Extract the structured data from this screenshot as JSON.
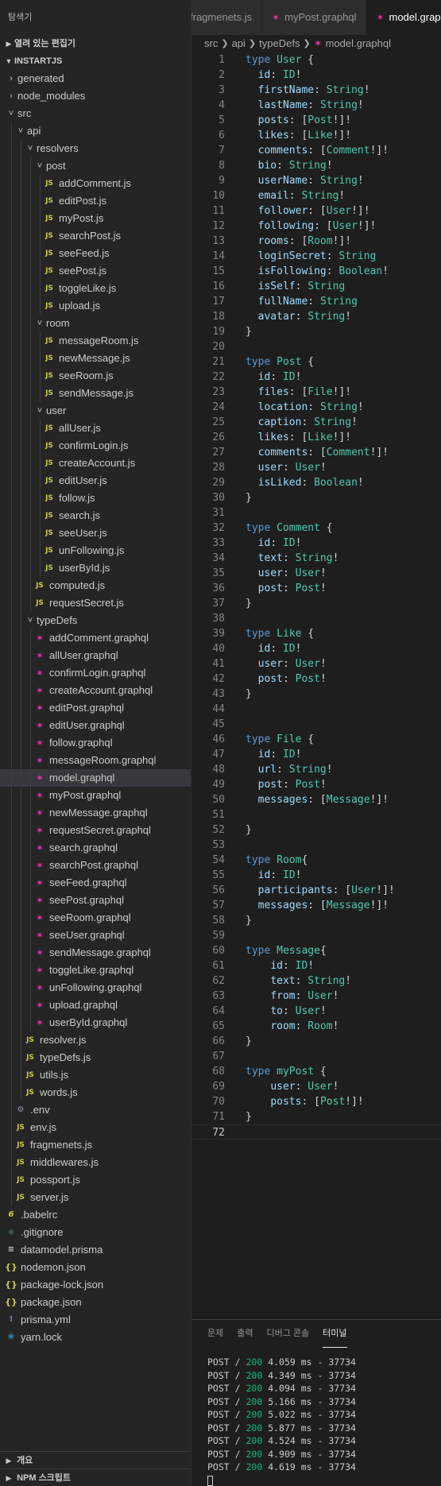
{
  "sidebar": {
    "title": "탐색기",
    "open_editors_label": "열려 있는 편집기",
    "project_label": "INSTARTJS",
    "bottom_sections": [
      "개요",
      "NPM 스크립트"
    ]
  },
  "tree": [
    {
      "label": "generated",
      "depth": 0,
      "kind": "folder",
      "open": false
    },
    {
      "label": "node_modules",
      "depth": 0,
      "kind": "folder",
      "open": false
    },
    {
      "label": "src",
      "depth": 0,
      "kind": "folder",
      "open": true
    },
    {
      "label": "api",
      "depth": 1,
      "kind": "folder",
      "open": true
    },
    {
      "label": "resolvers",
      "depth": 2,
      "kind": "folder",
      "open": true
    },
    {
      "label": "post",
      "depth": 3,
      "kind": "folder",
      "open": true
    },
    {
      "label": "addComment.js",
      "depth": 4,
      "kind": "js"
    },
    {
      "label": "editPost.js",
      "depth": 4,
      "kind": "js"
    },
    {
      "label": "myPost.js",
      "depth": 4,
      "kind": "js"
    },
    {
      "label": "searchPost.js",
      "depth": 4,
      "kind": "js"
    },
    {
      "label": "seeFeed.js",
      "depth": 4,
      "kind": "js"
    },
    {
      "label": "seePost.js",
      "depth": 4,
      "kind": "js"
    },
    {
      "label": "toggleLike.js",
      "depth": 4,
      "kind": "js"
    },
    {
      "label": "upload.js",
      "depth": 4,
      "kind": "js"
    },
    {
      "label": "room",
      "depth": 3,
      "kind": "folder",
      "open": true
    },
    {
      "label": "messageRoom.js",
      "depth": 4,
      "kind": "js"
    },
    {
      "label": "newMessage.js",
      "depth": 4,
      "kind": "js"
    },
    {
      "label": "seeRoom.js",
      "depth": 4,
      "kind": "js"
    },
    {
      "label": "sendMessage.js",
      "depth": 4,
      "kind": "js"
    },
    {
      "label": "user",
      "depth": 3,
      "kind": "folder",
      "open": true
    },
    {
      "label": "allUser.js",
      "depth": 4,
      "kind": "js"
    },
    {
      "label": "confirmLogin.js",
      "depth": 4,
      "kind": "js"
    },
    {
      "label": "createAccount.js",
      "depth": 4,
      "kind": "js"
    },
    {
      "label": "editUser.js",
      "depth": 4,
      "kind": "js"
    },
    {
      "label": "follow.js",
      "depth": 4,
      "kind": "js"
    },
    {
      "label": "search.js",
      "depth": 4,
      "kind": "js"
    },
    {
      "label": "seeUser.js",
      "depth": 4,
      "kind": "js"
    },
    {
      "label": "unFollowing.js",
      "depth": 4,
      "kind": "js"
    },
    {
      "label": "userById.js",
      "depth": 4,
      "kind": "js"
    },
    {
      "label": "computed.js",
      "depth": 3,
      "kind": "js"
    },
    {
      "label": "requestSecret.js",
      "depth": 3,
      "kind": "js"
    },
    {
      "label": "typeDefs",
      "depth": 2,
      "kind": "folder",
      "open": true
    },
    {
      "label": "addComment.graphql",
      "depth": 3,
      "kind": "graphql"
    },
    {
      "label": "allUser.graphql",
      "depth": 3,
      "kind": "graphql"
    },
    {
      "label": "confirmLogin.graphql",
      "depth": 3,
      "kind": "graphql"
    },
    {
      "label": "createAccount.graphql",
      "depth": 3,
      "kind": "graphql"
    },
    {
      "label": "editPost.graphql",
      "depth": 3,
      "kind": "graphql"
    },
    {
      "label": "editUser.graphql",
      "depth": 3,
      "kind": "graphql"
    },
    {
      "label": "follow.graphql",
      "depth": 3,
      "kind": "graphql"
    },
    {
      "label": "messageRoom.graphql",
      "depth": 3,
      "kind": "graphql"
    },
    {
      "label": "model.graphql",
      "depth": 3,
      "kind": "graphql",
      "active": true
    },
    {
      "label": "myPost.graphql",
      "depth": 3,
      "kind": "graphql"
    },
    {
      "label": "newMessage.graphql",
      "depth": 3,
      "kind": "graphql"
    },
    {
      "label": "requestSecret.graphql",
      "depth": 3,
      "kind": "graphql"
    },
    {
      "label": "search.graphql",
      "depth": 3,
      "kind": "graphql"
    },
    {
      "label": "searchPost.graphql",
      "depth": 3,
      "kind": "graphql"
    },
    {
      "label": "seeFeed.graphql",
      "depth": 3,
      "kind": "graphql"
    },
    {
      "label": "seePost.graphql",
      "depth": 3,
      "kind": "graphql"
    },
    {
      "label": "seeRoom.graphql",
      "depth": 3,
      "kind": "graphql"
    },
    {
      "label": "seeUser.graphql",
      "depth": 3,
      "kind": "graphql"
    },
    {
      "label": "sendMessage.graphql",
      "depth": 3,
      "kind": "graphql"
    },
    {
      "label": "toggleLike.graphql",
      "depth": 3,
      "kind": "graphql"
    },
    {
      "label": "unFollowing.graphql",
      "depth": 3,
      "kind": "graphql"
    },
    {
      "label": "upload.graphql",
      "depth": 3,
      "kind": "graphql"
    },
    {
      "label": "userById.graphql",
      "depth": 3,
      "kind": "graphql"
    },
    {
      "label": "resolver.js",
      "depth": 2,
      "kind": "js"
    },
    {
      "label": "typeDefs.js",
      "depth": 2,
      "kind": "js"
    },
    {
      "label": "utils.js",
      "depth": 2,
      "kind": "js"
    },
    {
      "label": "words.js",
      "depth": 2,
      "kind": "js"
    },
    {
      "label": ".env",
      "depth": 1,
      "kind": "env"
    },
    {
      "label": "env.js",
      "depth": 1,
      "kind": "js"
    },
    {
      "label": "fragmenets.js",
      "depth": 1,
      "kind": "js"
    },
    {
      "label": "middlewares.js",
      "depth": 1,
      "kind": "js"
    },
    {
      "label": "possport.js",
      "depth": 1,
      "kind": "js"
    },
    {
      "label": "server.js",
      "depth": 1,
      "kind": "js"
    },
    {
      "label": ".babelrc",
      "depth": 0,
      "kind": "babel"
    },
    {
      "label": ".gitignore",
      "depth": 0,
      "kind": "git"
    },
    {
      "label": "datamodel.prisma",
      "depth": 0,
      "kind": "prisma"
    },
    {
      "label": "nodemon.json",
      "depth": 0,
      "kind": "json"
    },
    {
      "label": "package-lock.json",
      "depth": 0,
      "kind": "json"
    },
    {
      "label": "package.json",
      "depth": 0,
      "kind": "json"
    },
    {
      "label": "prisma.yml",
      "depth": 0,
      "kind": "yml"
    },
    {
      "label": "yarn.lock",
      "depth": 0,
      "kind": "yarn"
    }
  ],
  "icons": {
    "folder_open": "chevron-down-icon",
    "folder_closed": "chevron-right-icon",
    "js": "JS",
    "graphql": "graphql-icon",
    "json": "{}",
    "yml": "!",
    "env": "gear-icon"
  },
  "tabs": [
    {
      "label": "fragmenets.js",
      "kind": "js",
      "active": false
    },
    {
      "label": "myPost.graphql",
      "kind": "graphql",
      "active": false
    },
    {
      "label": "model.graphql",
      "kind": "graphql",
      "active": true
    }
  ],
  "breadcrumb": [
    "src",
    "api",
    "typeDefs",
    "model.graphql"
  ],
  "code_lines": [
    "type User {",
    "  id: ID!",
    "  firstName: String!",
    "  lastName: String!",
    "  posts: [Post!]!",
    "  likes: [Like!]!",
    "  comments: [Comment!]!",
    "  bio: String!",
    "  userName: String!",
    "  email: String!",
    "  follower: [User!]!",
    "  following: [User!]!",
    "  rooms: [Room!]!",
    "  loginSecret: String",
    "  isFollowing: Boolean!",
    "  isSelf: String",
    "  fullName: String",
    "  avatar: String!",
    "}",
    "",
    "type Post {",
    "  id: ID!",
    "  files: [File!]!",
    "  location: String!",
    "  caption: String!",
    "  likes: [Like!]!",
    "  comments: [Comment!]!",
    "  user: User!",
    "  isLiked: Boolean!",
    "}",
    "",
    "type Comment {",
    "  id: ID!",
    "  text: String!",
    "  user: User!",
    "  post: Post!",
    "}",
    "",
    "type Like {",
    "  id: ID!",
    "  user: User!",
    "  post: Post!",
    "}",
    "",
    "",
    "type File {",
    "  id: ID!",
    "  url: String!",
    "  post: Post!",
    "  messages: [Message!]!",
    "",
    "}",
    "",
    "type Room{",
    "  id: ID!",
    "  participants: [User!]!",
    "  messages: [Message!]!",
    "}",
    "",
    "type Message{",
    "    id: ID!",
    "    text: String!",
    "    from: User!",
    "    to: User!",
    "    room: Room!",
    "}",
    "",
    "type myPost {",
    "    user: User!",
    "    posts: [Post!]!",
    "}",
    ""
  ],
  "panel": {
    "tabs": [
      "문제",
      "출력",
      "디버그 콘솔",
      "터미널"
    ],
    "active_tab": "터미널",
    "terminal_lines": [
      {
        "method": "POST",
        "path": "/",
        "status": "200",
        "time": "4.059 ms",
        "size": "37734"
      },
      {
        "method": "POST",
        "path": "/",
        "status": "200",
        "time": "4.349 ms",
        "size": "37734"
      },
      {
        "method": "POST",
        "path": "/",
        "status": "200",
        "time": "4.094 ms",
        "size": "37734"
      },
      {
        "method": "POST",
        "path": "/",
        "status": "200",
        "time": "5.166 ms",
        "size": "37734"
      },
      {
        "method": "POST",
        "path": "/",
        "status": "200",
        "time": "5.022 ms",
        "size": "37734"
      },
      {
        "method": "POST",
        "path": "/",
        "status": "200",
        "time": "5.877 ms",
        "size": "37734"
      },
      {
        "method": "POST",
        "path": "/",
        "status": "200",
        "time": "4.524 ms",
        "size": "37734"
      },
      {
        "method": "POST",
        "path": "/",
        "status": "200",
        "time": "4.909 ms",
        "size": "37734"
      },
      {
        "method": "POST",
        "path": "/",
        "status": "200",
        "time": "4.619 ms",
        "size": "37734"
      }
    ]
  },
  "colors": {
    "keyword": "#569cd6",
    "type": "#4ec9b0",
    "field": "#9cdcfe",
    "graphql_icon": "#e535ab",
    "js_icon": "#cbcb41",
    "status_ok": "#0dbc79"
  }
}
